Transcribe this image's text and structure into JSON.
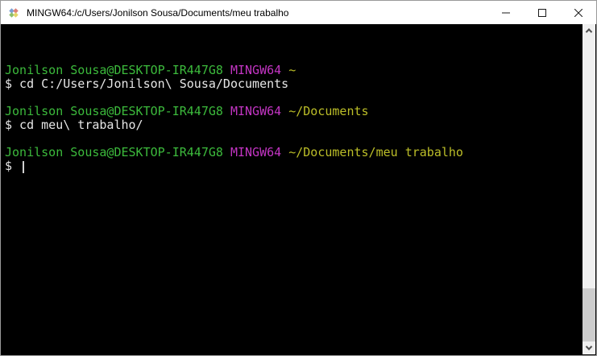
{
  "window": {
    "title": "MINGW64:/c/Users/Jonilson Sousa/Documents/meu trabalho",
    "icon": "msys2-diamond-icon",
    "controls": [
      {
        "name": "minimize",
        "glyph": "minimize-icon"
      },
      {
        "name": "maximize",
        "glyph": "maximize-icon"
      },
      {
        "name": "close",
        "glyph": "close-icon"
      }
    ]
  },
  "terminal": {
    "colors": {
      "background": "#000000",
      "foreground": "#e6e6e6",
      "green": "#3cba3c",
      "magenta": "#c335c3",
      "yellow": "#bcbe28"
    },
    "lines": [
      {
        "type": "prompt",
        "user_host": "Jonilson Sousa@DESKTOP-IR447G8",
        "env": "MINGW64",
        "path": "~"
      },
      {
        "type": "command",
        "text": "$ cd C:/Users/Jonilson\\ Sousa/Documents"
      },
      {
        "type": "blank"
      },
      {
        "type": "prompt",
        "user_host": "Jonilson Sousa@DESKTOP-IR447G8",
        "env": "MINGW64",
        "path": "~/Documents"
      },
      {
        "type": "command",
        "text": "$ cd meu\\ trabalho/"
      },
      {
        "type": "blank"
      },
      {
        "type": "prompt",
        "user_host": "Jonilson Sousa@DESKTOP-IR447G8",
        "env": "MINGW64",
        "path": "~/Documents/meu trabalho"
      },
      {
        "type": "command",
        "text": "$ ",
        "cursor": true
      }
    ]
  }
}
